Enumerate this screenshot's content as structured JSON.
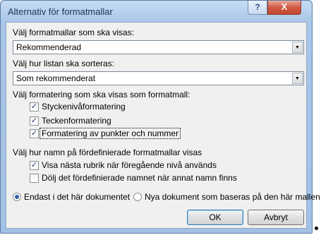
{
  "window": {
    "title": "Alternativ för formatmallar",
    "help_glyph": "?",
    "close_glyph": "X"
  },
  "section_show": {
    "label": "Välj formatmallar som ska visas:",
    "selected": "Rekommenderad"
  },
  "section_sort": {
    "label": "Välj hur listan ska sorteras:",
    "selected": "Som rekommenderat"
  },
  "section_formatting": {
    "label": "Välj formatering som ska visas som formatmall:",
    "items": [
      {
        "label": "Styckenivåformatering",
        "checked": true
      },
      {
        "label": "Teckenformatering",
        "checked": true
      },
      {
        "label": "Formatering av punkter och nummer",
        "checked": true
      }
    ]
  },
  "section_names": {
    "label": "Välj hur namn på fördefinierade formatmallar visas",
    "items": [
      {
        "label": "Visa nästa rubrik när föregående nivå används",
        "checked": true
      },
      {
        "label": "Dölj det fördefinierade namnet när annat namn finns",
        "checked": false
      }
    ]
  },
  "scope": {
    "options": [
      {
        "label": "Endast i det här dokumentet",
        "selected": true
      },
      {
        "label": "Nya dokument som baseras på den här mallen",
        "selected": false
      }
    ]
  },
  "buttons": {
    "ok": "OK",
    "cancel": "Avbryt"
  },
  "glyphs": {
    "check": "✓",
    "dropdown_arrow": "▼"
  }
}
